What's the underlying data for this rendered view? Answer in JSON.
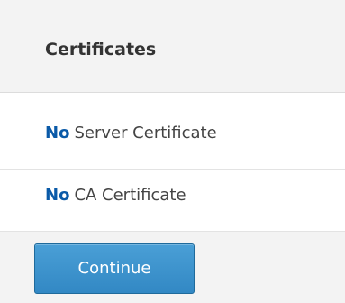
{
  "panel": {
    "title": "Certificates"
  },
  "certificates": [
    {
      "status": "No",
      "label": "Server Certificate"
    },
    {
      "status": "No",
      "label": "CA Certificate"
    }
  ],
  "actions": {
    "continue_label": "Continue"
  },
  "colors": {
    "status_text": "#0a5aa8",
    "button": "#3a8fcb",
    "header_background": "#f3f3f3",
    "row_background": "#ffffff"
  }
}
